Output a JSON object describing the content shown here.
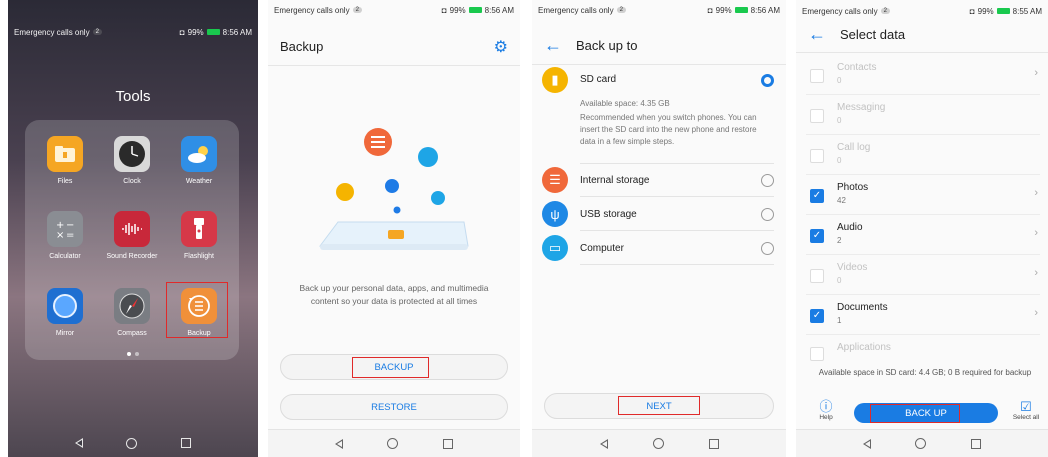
{
  "colors": {
    "accent": "#1a7ce3",
    "highlight_box": "#e02a2a"
  },
  "panel1": {
    "status": {
      "carrier": "Emergency calls only",
      "sim": "2",
      "battery": "99%",
      "time": "8:56 AM"
    },
    "folder_title": "Tools",
    "apps": [
      {
        "label": "Files",
        "icon": "folder-icon"
      },
      {
        "label": "Clock",
        "icon": "clock-icon"
      },
      {
        "label": "Weather",
        "icon": "weather-icon"
      },
      {
        "label": "Calculator",
        "icon": "calculator-icon"
      },
      {
        "label": "Sound Recorder",
        "icon": "sound-recorder-icon"
      },
      {
        "label": "Flashlight",
        "icon": "flashlight-icon"
      },
      {
        "label": "Mirror",
        "icon": "mirror-icon"
      },
      {
        "label": "Compass",
        "icon": "compass-icon"
      },
      {
        "label": "Backup",
        "icon": "backup-icon"
      }
    ]
  },
  "panel2": {
    "status": {
      "carrier": "Emergency calls only",
      "sim": "2",
      "battery": "99%",
      "time": "8:56 AM"
    },
    "title": "Backup",
    "description": "Back up your personal data, apps, and multimedia content so your data is protected at all times",
    "backup_label": "BACKUP",
    "restore_label": "RESTORE"
  },
  "panel3": {
    "status": {
      "carrier": "Emergency calls only",
      "sim": "2",
      "battery": "99%",
      "time": "8:56 AM"
    },
    "title": "Back up to",
    "options": [
      {
        "label": "SD card",
        "selected": true
      },
      {
        "label": "Internal storage",
        "selected": false
      },
      {
        "label": "USB storage",
        "selected": false
      },
      {
        "label": "Computer",
        "selected": false
      }
    ],
    "sd_available": "Available space: 4.35 GB",
    "sd_note": "Recommended when you switch phones. You can insert the SD card into the new phone and restore data in a few simple steps.",
    "next_label": "NEXT"
  },
  "panel4": {
    "status": {
      "carrier": "Emergency calls only",
      "sim": "2",
      "battery": "99%",
      "time": "8:55 AM"
    },
    "title": "Select data",
    "items": [
      {
        "name": "Contacts",
        "count": "0",
        "checked": false
      },
      {
        "name": "Messaging",
        "count": "0",
        "checked": false
      },
      {
        "name": "Call log",
        "count": "0",
        "checked": false
      },
      {
        "name": "Photos",
        "count": "42",
        "checked": true
      },
      {
        "name": "Audio",
        "count": "2",
        "checked": true
      },
      {
        "name": "Videos",
        "count": "0",
        "checked": false
      },
      {
        "name": "Documents",
        "count": "1",
        "checked": true
      },
      {
        "name": "Applications",
        "count": "",
        "checked": false
      }
    ],
    "available": "Available space in SD card: 4.4 GB; 0 B required for backup",
    "help_label": "Help",
    "backup_label": "BACK UP",
    "select_all_label": "Select all"
  }
}
